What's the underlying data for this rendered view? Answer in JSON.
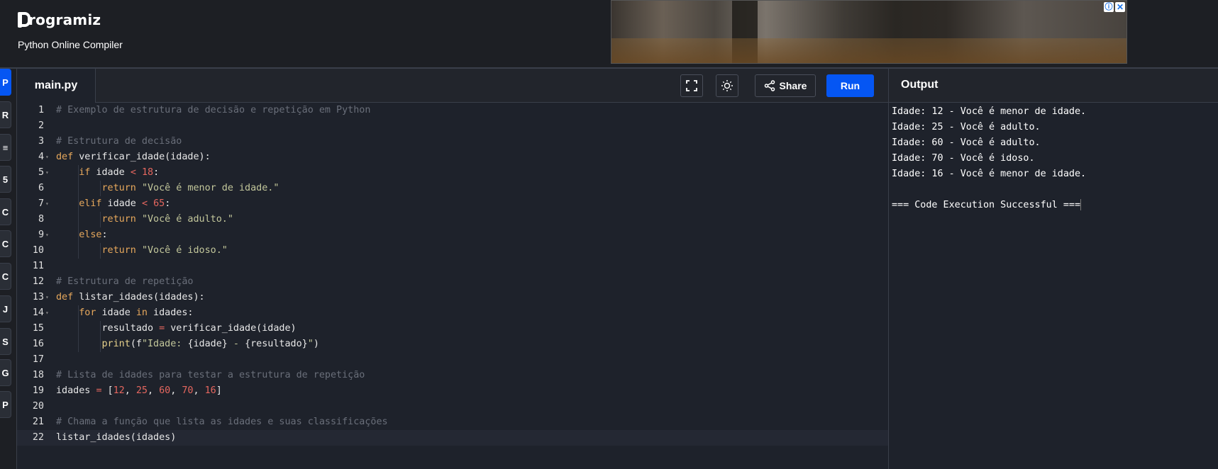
{
  "header": {
    "logo_text": "rogramiz",
    "subtitle": "Python Online Compiler",
    "ad_info": "ⓘ",
    "ad_close": "✕"
  },
  "sidebar": {
    "icons": [
      "python-icon",
      "r-icon",
      "sql-icon",
      "html-icon",
      "c-icon",
      "cpp-icon",
      "csharp-icon",
      "java-icon",
      "swift-icon",
      "go-icon",
      "php-icon"
    ],
    "active_index": 0
  },
  "editor": {
    "tab_label": "main.py",
    "share_label": "Share",
    "run_label": "Run",
    "lines": [
      {
        "n": "1"
      },
      {
        "n": "2"
      },
      {
        "n": "3"
      },
      {
        "n": "4"
      },
      {
        "n": "5"
      },
      {
        "n": "6"
      },
      {
        "n": "7"
      },
      {
        "n": "8"
      },
      {
        "n": "9"
      },
      {
        "n": "10"
      },
      {
        "n": "11"
      },
      {
        "n": "12"
      },
      {
        "n": "13"
      },
      {
        "n": "14"
      },
      {
        "n": "15"
      },
      {
        "n": "16"
      },
      {
        "n": "17"
      },
      {
        "n": "18"
      },
      {
        "n": "19"
      },
      {
        "n": "20"
      },
      {
        "n": "21"
      },
      {
        "n": "22"
      }
    ],
    "code": [
      [
        {
          "t": "c",
          "v": "# Exemplo de estrutura de decisão e repetição em Python"
        }
      ],
      [],
      [
        {
          "t": "c",
          "v": "# Estrutura de decisão"
        }
      ],
      [
        {
          "t": "k",
          "v": "def"
        },
        {
          "t": "",
          "v": " verificar_idade(idade):"
        }
      ],
      [
        {
          "t": "",
          "v": "    "
        },
        {
          "t": "k",
          "v": "if"
        },
        {
          "t": "",
          "v": " idade "
        },
        {
          "t": "o",
          "v": "<"
        },
        {
          "t": "",
          "v": " "
        },
        {
          "t": "n",
          "v": "18"
        },
        {
          "t": "",
          "v": ":"
        }
      ],
      [
        {
          "t": "",
          "v": "        "
        },
        {
          "t": "k",
          "v": "return"
        },
        {
          "t": "",
          "v": " "
        },
        {
          "t": "s",
          "v": "\"Você é menor de idade.\""
        }
      ],
      [
        {
          "t": "",
          "v": "    "
        },
        {
          "t": "k",
          "v": "elif"
        },
        {
          "t": "",
          "v": " idade "
        },
        {
          "t": "o",
          "v": "<"
        },
        {
          "t": "",
          "v": " "
        },
        {
          "t": "n",
          "v": "65"
        },
        {
          "t": "",
          "v": ":"
        }
      ],
      [
        {
          "t": "",
          "v": "        "
        },
        {
          "t": "k",
          "v": "return"
        },
        {
          "t": "",
          "v": " "
        },
        {
          "t": "s",
          "v": "\"Você é adulto.\""
        }
      ],
      [
        {
          "t": "",
          "v": "    "
        },
        {
          "t": "k",
          "v": "else"
        },
        {
          "t": "",
          "v": ":"
        }
      ],
      [
        {
          "t": "",
          "v": "        "
        },
        {
          "t": "k",
          "v": "return"
        },
        {
          "t": "",
          "v": " "
        },
        {
          "t": "s",
          "v": "\"Você é idoso.\""
        }
      ],
      [],
      [
        {
          "t": "c",
          "v": "# Estrutura de repetição"
        }
      ],
      [
        {
          "t": "k",
          "v": "def"
        },
        {
          "t": "",
          "v": " listar_idades(idades):"
        }
      ],
      [
        {
          "t": "",
          "v": "    "
        },
        {
          "t": "k",
          "v": "for"
        },
        {
          "t": "",
          "v": " idade "
        },
        {
          "t": "k",
          "v": "in"
        },
        {
          "t": "",
          "v": " idades:"
        }
      ],
      [
        {
          "t": "",
          "v": "        resultado "
        },
        {
          "t": "o",
          "v": "="
        },
        {
          "t": "",
          "v": " verificar_idade(idade)"
        }
      ],
      [
        {
          "t": "",
          "v": "        "
        },
        {
          "t": "f",
          "v": "print"
        },
        {
          "t": "",
          "v": "(f"
        },
        {
          "t": "s",
          "v": "\"Idade: "
        },
        {
          "t": "",
          "v": "{idade}"
        },
        {
          "t": "s",
          "v": " - "
        },
        {
          "t": "",
          "v": "{resultado}"
        },
        {
          "t": "s",
          "v": "\""
        },
        {
          "t": "",
          "v": ")"
        }
      ],
      [],
      [
        {
          "t": "c",
          "v": "# Lista de idades para testar a estrutura de repetição"
        }
      ],
      [
        {
          "t": "",
          "v": "idades "
        },
        {
          "t": "o",
          "v": "="
        },
        {
          "t": "",
          "v": " ["
        },
        {
          "t": "n",
          "v": "12"
        },
        {
          "t": "",
          "v": ", "
        },
        {
          "t": "n",
          "v": "25"
        },
        {
          "t": "",
          "v": ", "
        },
        {
          "t": "n",
          "v": "60"
        },
        {
          "t": "",
          "v": ", "
        },
        {
          "t": "n",
          "v": "70"
        },
        {
          "t": "",
          "v": ", "
        },
        {
          "t": "n",
          "v": "16"
        },
        {
          "t": "",
          "v": "]"
        }
      ],
      [],
      [
        {
          "t": "c",
          "v": "# Chama a função que lista as idades e suas classificações"
        }
      ],
      [
        {
          "t": "",
          "v": "listar_idades(idades)"
        }
      ]
    ],
    "fold_lines": [
      4,
      5,
      7,
      9,
      13,
      14
    ],
    "current_line": 22
  },
  "output": {
    "title": "Output",
    "lines": [
      "Idade: 12 - Você é menor de idade.",
      "Idade: 25 - Você é adulto.",
      "Idade: 60 - Você é adulto.",
      "Idade: 70 - Você é idoso.",
      "Idade: 16 - Você é menor de idade.",
      "",
      "=== Code Execution Successful ==="
    ]
  }
}
